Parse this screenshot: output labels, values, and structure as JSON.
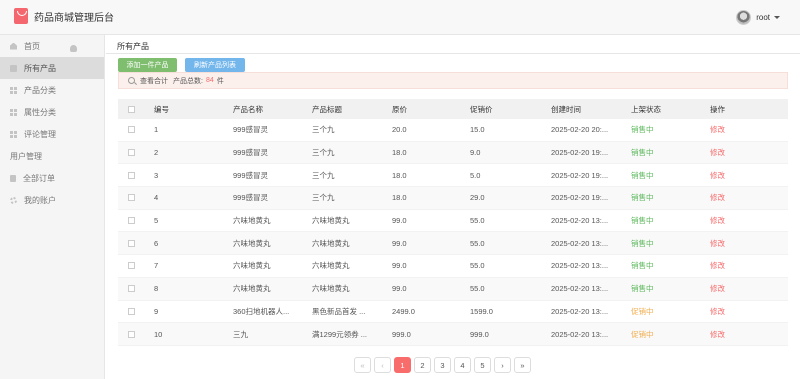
{
  "app": {
    "title": "药品商城管理后台"
  },
  "user": {
    "name": "root"
  },
  "sidebar": {
    "items": [
      {
        "label": "首页",
        "icon": "home-icon"
      },
      {
        "label": "所有产品",
        "icon": "checkbox-icon",
        "active": true
      },
      {
        "label": "产品分类",
        "icon": "grid-icon"
      },
      {
        "label": "属性分类",
        "icon": "grid-icon"
      },
      {
        "label": "评论管理",
        "icon": "grid-icon"
      },
      {
        "label": "用户管理",
        "icon": "user-icon"
      },
      {
        "label": "全部订单",
        "icon": "document-icon"
      },
      {
        "label": "我的账户",
        "icon": "gear-icon"
      }
    ]
  },
  "main": {
    "breadcrumb": "所有产品",
    "add_button": "添加一件产品",
    "refresh_button": "刷新产品列表",
    "summary": {
      "prefix": "查看合计",
      "label": "产品总数:",
      "count": "84",
      "unit": "件"
    }
  },
  "table": {
    "headers": [
      "编号",
      "产品名称",
      "产品标题",
      "原价",
      "促销价",
      "创建时间",
      "上架状态",
      "操作"
    ],
    "rows": [
      {
        "id": "1",
        "name": "999感冒灵",
        "title": "三个九",
        "price": "20.0",
        "promo": "15.0",
        "time": "2025-02-20 20:...",
        "status": "销售中",
        "op": "修改"
      },
      {
        "id": "2",
        "name": "999感冒灵",
        "title": "三个九",
        "price": "18.0",
        "promo": "9.0",
        "time": "2025-02-20 19:...",
        "status": "销售中",
        "op": "修改"
      },
      {
        "id": "3",
        "name": "999感冒灵",
        "title": "三个九",
        "price": "18.0",
        "promo": "5.0",
        "time": "2025-02-20 19:...",
        "status": "销售中",
        "op": "修改"
      },
      {
        "id": "4",
        "name": "999感冒灵",
        "title": "三个九",
        "price": "18.0",
        "promo": "29.0",
        "time": "2025-02-20 19:...",
        "status": "销售中",
        "op": "修改"
      },
      {
        "id": "5",
        "name": "六味地黄丸",
        "title": "六味地黄丸",
        "price": "99.0",
        "promo": "55.0",
        "time": "2025-02-20 13:...",
        "status": "销售中",
        "op": "修改"
      },
      {
        "id": "6",
        "name": "六味地黄丸",
        "title": "六味地黄丸",
        "price": "99.0",
        "promo": "55.0",
        "time": "2025-02-20 13:...",
        "status": "销售中",
        "op": "修改"
      },
      {
        "id": "7",
        "name": "六味地黄丸",
        "title": "六味地黄丸",
        "price": "99.0",
        "promo": "55.0",
        "time": "2025-02-20 13:...",
        "status": "销售中",
        "op": "修改"
      },
      {
        "id": "8",
        "name": "六味地黄丸",
        "title": "六味地黄丸",
        "price": "99.0",
        "promo": "55.0",
        "time": "2025-02-20 13:...",
        "status": "销售中",
        "op": "修改"
      },
      {
        "id": "9",
        "name": "360扫地机器人...",
        "title": "黑色新品首发 ...",
        "price": "2499.0",
        "promo": "1599.0",
        "time": "2025-02-20 13:...",
        "status": "促销中",
        "op": "修改"
      },
      {
        "id": "10",
        "name": "三九",
        "title": "满1299元领券 ...",
        "price": "999.0",
        "promo": "999.0",
        "time": "2025-02-20 13:...",
        "status": "促销中",
        "op": "修改"
      }
    ]
  },
  "pagination": {
    "first": "«",
    "prev": "‹",
    "pages": [
      "1",
      "2",
      "3",
      "4",
      "5"
    ],
    "current": "1",
    "next": "›",
    "last": "»"
  },
  "colors": {
    "accent": "#f96c6c",
    "add_button": "#7fbe6f",
    "refresh_button": "#73b6eb",
    "status_on_sale": "#5cb85c",
    "status_promo": "#f0ad4e",
    "edit_link": "#f56c6c"
  }
}
